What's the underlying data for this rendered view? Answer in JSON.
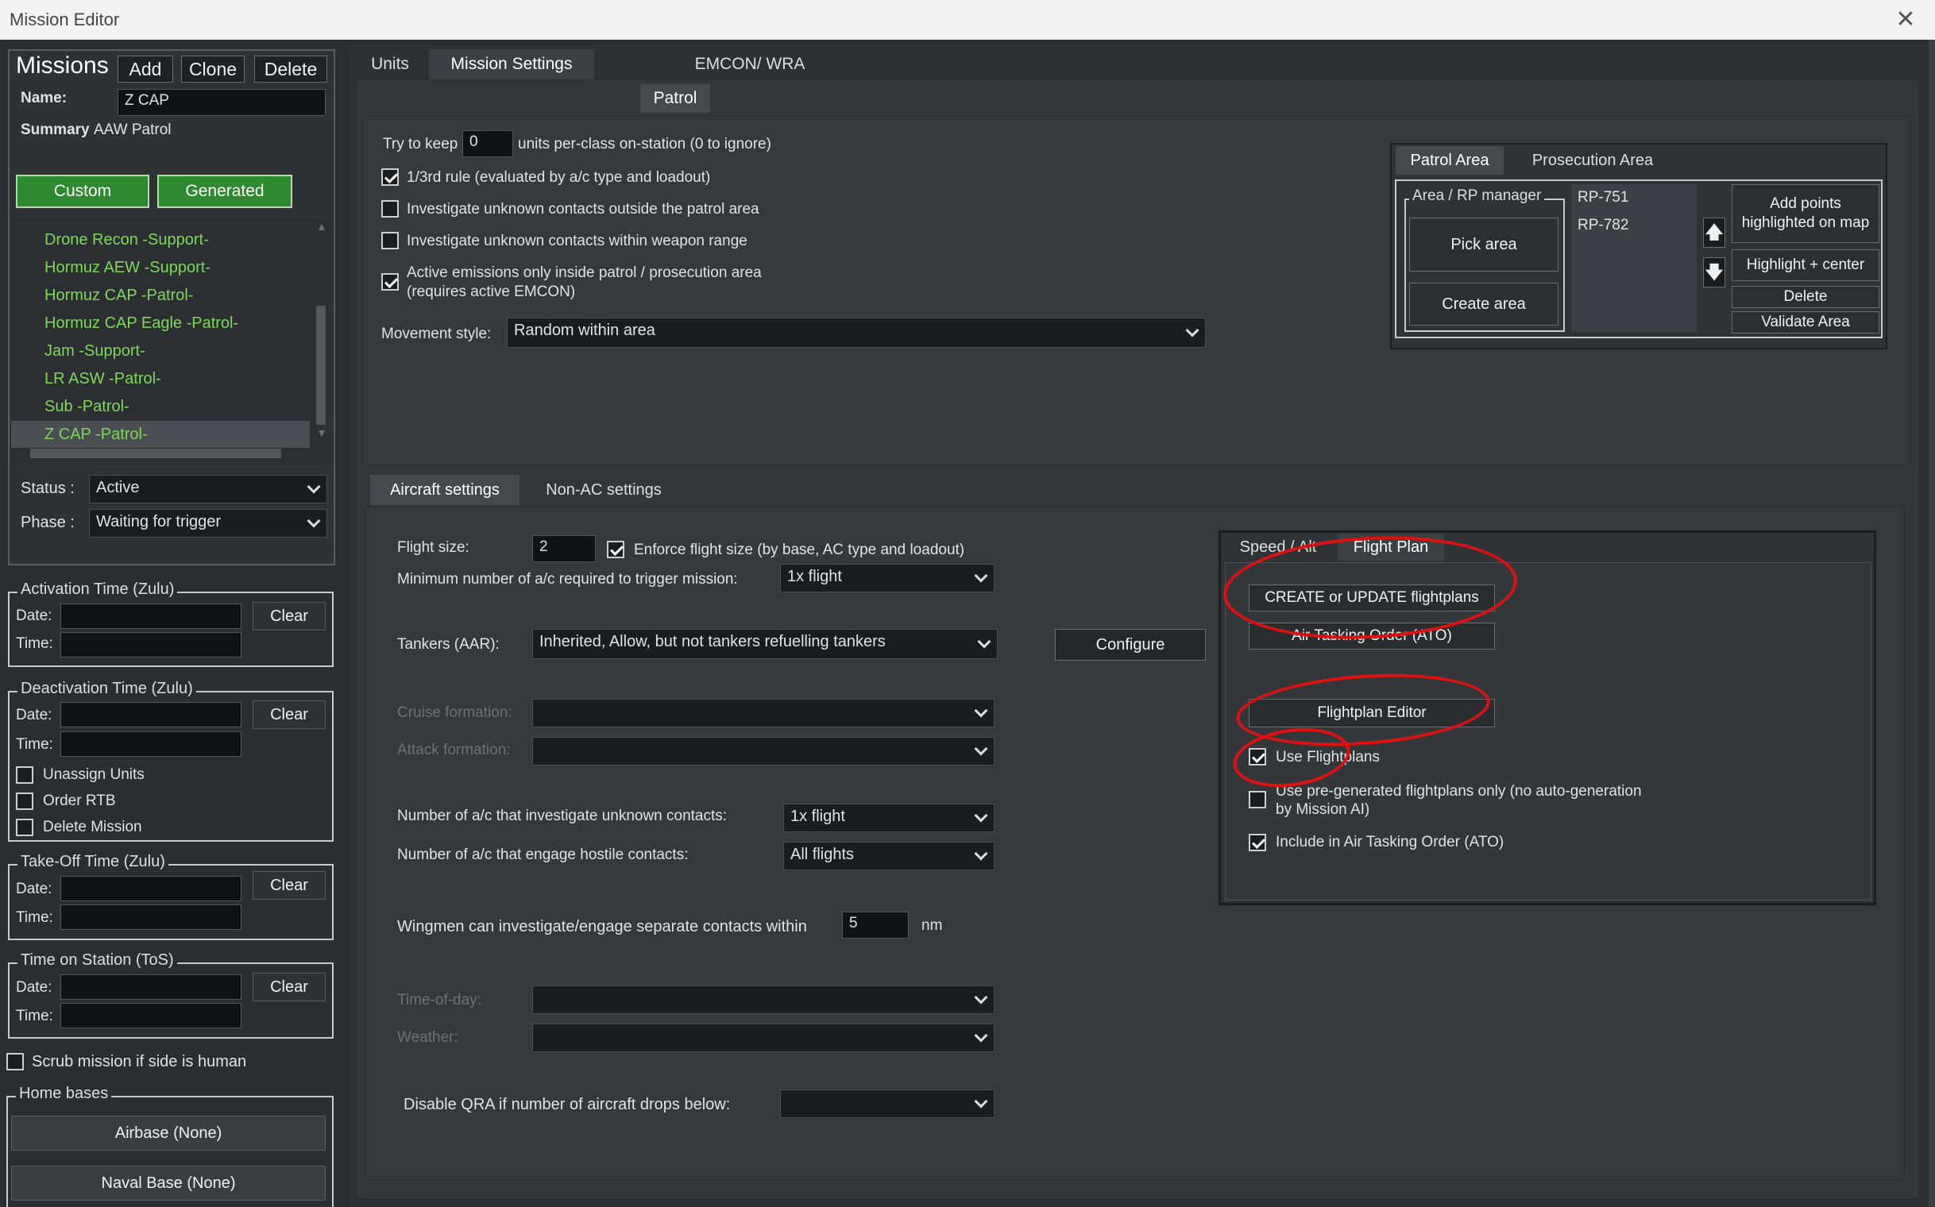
{
  "window": {
    "title": "Mission Editor",
    "close_icon": "close-icon"
  },
  "left": {
    "missions_label": "Missions",
    "add_label": "Add",
    "clone_label": "Clone",
    "delete_label": "Delete",
    "name_label": "Name:",
    "name_value": "Z CAP",
    "summary_label": "Summary",
    "summary_value": "AAW Patrol",
    "custom_label": "Custom",
    "generated_label": "Generated",
    "missions": [
      "Drone Recon  -Support-",
      "Hormuz AEW  -Support-",
      "Hormuz CAP  -Patrol-",
      "Hormuz CAP Eagle  -Patrol-",
      "Jam  -Support-",
      "LR ASW  -Patrol-",
      "Sub  -Patrol-",
      "Z CAP  -Patrol-"
    ],
    "status_label": "Status :",
    "status_value": "Active",
    "phase_label": "Phase :",
    "phase_value": "Waiting for trigger",
    "activation_title": "Activation Time (Zulu)",
    "deactivation_title": "Deactivation Time (Zulu)",
    "takeoff_title": "Take-Off Time (Zulu)",
    "tos_title": "Time on Station (ToS)",
    "date_label": "Date:",
    "time_label": "Time:",
    "clear_label": "Clear",
    "unassign_label": "Unassign Units",
    "order_rtb_label": "Order RTB",
    "delete_mission_label": "Delete Mission",
    "scrub_label": "Scrub mission if side is human",
    "home_bases_title": "Home bases",
    "airbase_label": "Airbase (None)",
    "naval_base_label": "Naval Base (None)"
  },
  "tabs": {
    "units": "Units",
    "mission_settings": "Mission Settings",
    "emcon": "EMCON/ WRA",
    "patrol": "Patrol"
  },
  "patrol": {
    "try_keep_pre": "Try to keep",
    "try_keep_value": "0",
    "try_keep_post": "units per-class on-station (0 to ignore)",
    "one_third_label": "1/3rd rule (evaluated by a/c type and loadout)",
    "inv_outside_label": "Investigate unknown contacts outside the patrol area",
    "inv_weapon_label": "Investigate unknown contacts within weapon range",
    "active_emissions_label_1": "Active emissions only inside patrol / prosecution area",
    "active_emissions_label_2": "(requires active EMCON)",
    "movement_label": "Movement style:",
    "movement_value": "Random within area"
  },
  "area": {
    "tab_patrol": "Patrol Area",
    "tab_prosecution": "Prosecution Area",
    "manager_title": "Area / RP manager",
    "pick_area": "Pick area",
    "create_area": "Create area",
    "points": [
      "RP-751",
      "RP-782"
    ],
    "add_points": "Add points highlighted on map",
    "highlight_center": "Highlight + center",
    "delete": "Delete",
    "validate": "Validate Area"
  },
  "aircraft": {
    "tab_aircraft": "Aircraft settings",
    "tab_nonac": "Non-AC settings",
    "flight_size_label": "Flight size:",
    "flight_size_value": "2",
    "enforce_label": "Enforce flight size (by base, AC type and loadout)",
    "min_ac_label": "Minimum number of a/c required to trigger mission:",
    "min_ac_value": "1x flight",
    "tankers_label": "Tankers (AAR):",
    "tankers_value": "Inherited, Allow, but not tankers refuelling tankers",
    "configure_label": "Configure",
    "cruise_label": "Cruise formation:",
    "attack_label": "Attack formation:",
    "investigate_label": "Number of a/c that investigate unknown contacts:",
    "investigate_value": "1x flight",
    "engage_label": "Number of a/c that engage hostile contacts:",
    "engage_value": "All flights",
    "wingmen_label": "Wingmen can investigate/engage separate contacts within",
    "wingmen_value": "5",
    "wingmen_unit": "nm",
    "tod_label": "Time-of-day:",
    "weather_label": "Weather:",
    "qra_label": "Disable QRA if number of aircraft drops below:"
  },
  "flightplan": {
    "tab_speed": "Speed / Alt",
    "tab_plan": "Flight Plan",
    "create_update": "CREATE or UPDATE flightplans",
    "ato": "Air Tasking Order (ATO)",
    "editor": "Flightplan Editor",
    "use_label": "Use Flightplans",
    "pregen_label_1": "Use pre-generated flightplans only (no auto-generation",
    "pregen_label_2": "by Mission AI)",
    "include_ato_label": "Include in Air Tasking Order (ATO)"
  },
  "colors": {
    "mission_text": "#7ed957",
    "annotation": "#e01010",
    "custom_green": "#2e8a2e"
  }
}
